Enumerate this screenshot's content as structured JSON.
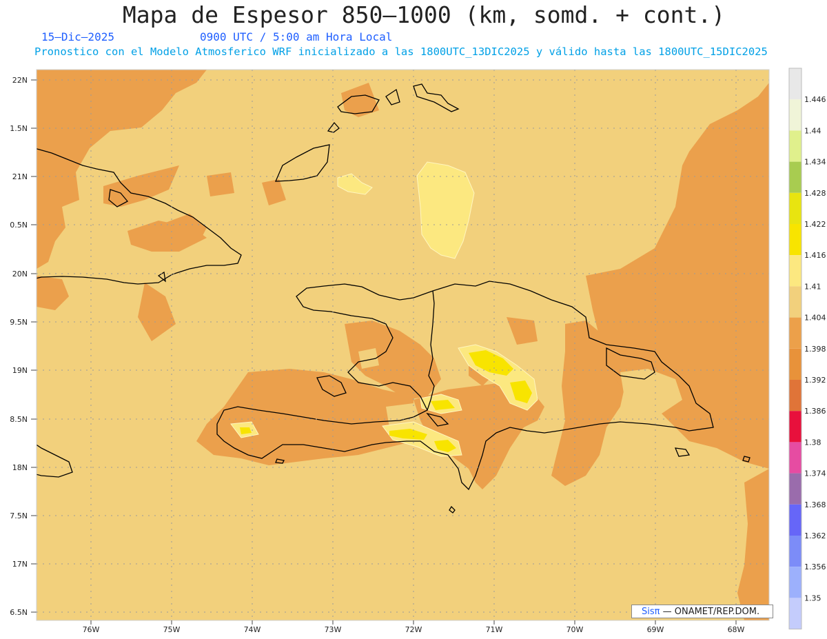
{
  "title": "Mapa de Espesor 850—1000 (km, somd. + cont.)",
  "date": "15—Dic—2025",
  "time": "0900 UTC / 5:00 am Hora Local",
  "forecast": "Pronostico con el Modelo Atmosferico WRF inicializado a las 1800UTC_13DIC2025 y válido hasta las  1800UTC_15DIC2025",
  "credit_sis": "Sisπ",
  "credit_rest": "— ONAMET/REP.DOM.",
  "lat_labels": [
    "22N",
    "1.5N",
    "21N",
    "0.5N",
    "20N",
    "9.5N",
    "19N",
    "8.5N",
    "18N",
    "7.5N",
    "17N",
    "6.5N"
  ],
  "lon_labels": [
    "76W",
    "75W",
    "74W",
    "73W",
    "72W",
    "71W",
    "70W",
    "69W",
    "68W"
  ],
  "legend": [
    {
      "label": "1.446",
      "color": "#e8e8e8"
    },
    {
      "label": "1.44",
      "color": "#f0f4d8"
    },
    {
      "label": "1.434",
      "color": "#e0f08c"
    },
    {
      "label": "1.428",
      "color": "#a8cc50"
    },
    {
      "label": "1.422",
      "color": "#e8e410"
    },
    {
      "label": "1.416",
      "color": "#f8e400"
    },
    {
      "label": "1.41",
      "color": "#fce880"
    },
    {
      "label": "1.404",
      "color": "#f2d07c"
    },
    {
      "label": "1.398",
      "color": "#eca04a"
    },
    {
      "label": "1.392",
      "color": "#e8923a"
    },
    {
      "label": "1.386",
      "color": "#e07438"
    },
    {
      "label": "1.38",
      "color": "#e8103c"
    },
    {
      "label": "1.374",
      "color": "#e64ca2"
    },
    {
      "label": "1.368",
      "color": "#9a6cac"
    },
    {
      "label": "1.362",
      "color": "#6666f8"
    },
    {
      "label": "1.356",
      "color": "#7c8cf8"
    },
    {
      "label": "1.35",
      "color": "#9cb0fc"
    },
    {
      "label": "",
      "color": "#c4ccfc"
    }
  ],
  "colors": {
    "base": "#f2d07c",
    "dark": "#eba04c",
    "light": "#fce880",
    "yellow": "#f8e400",
    "coast": "#000000"
  }
}
